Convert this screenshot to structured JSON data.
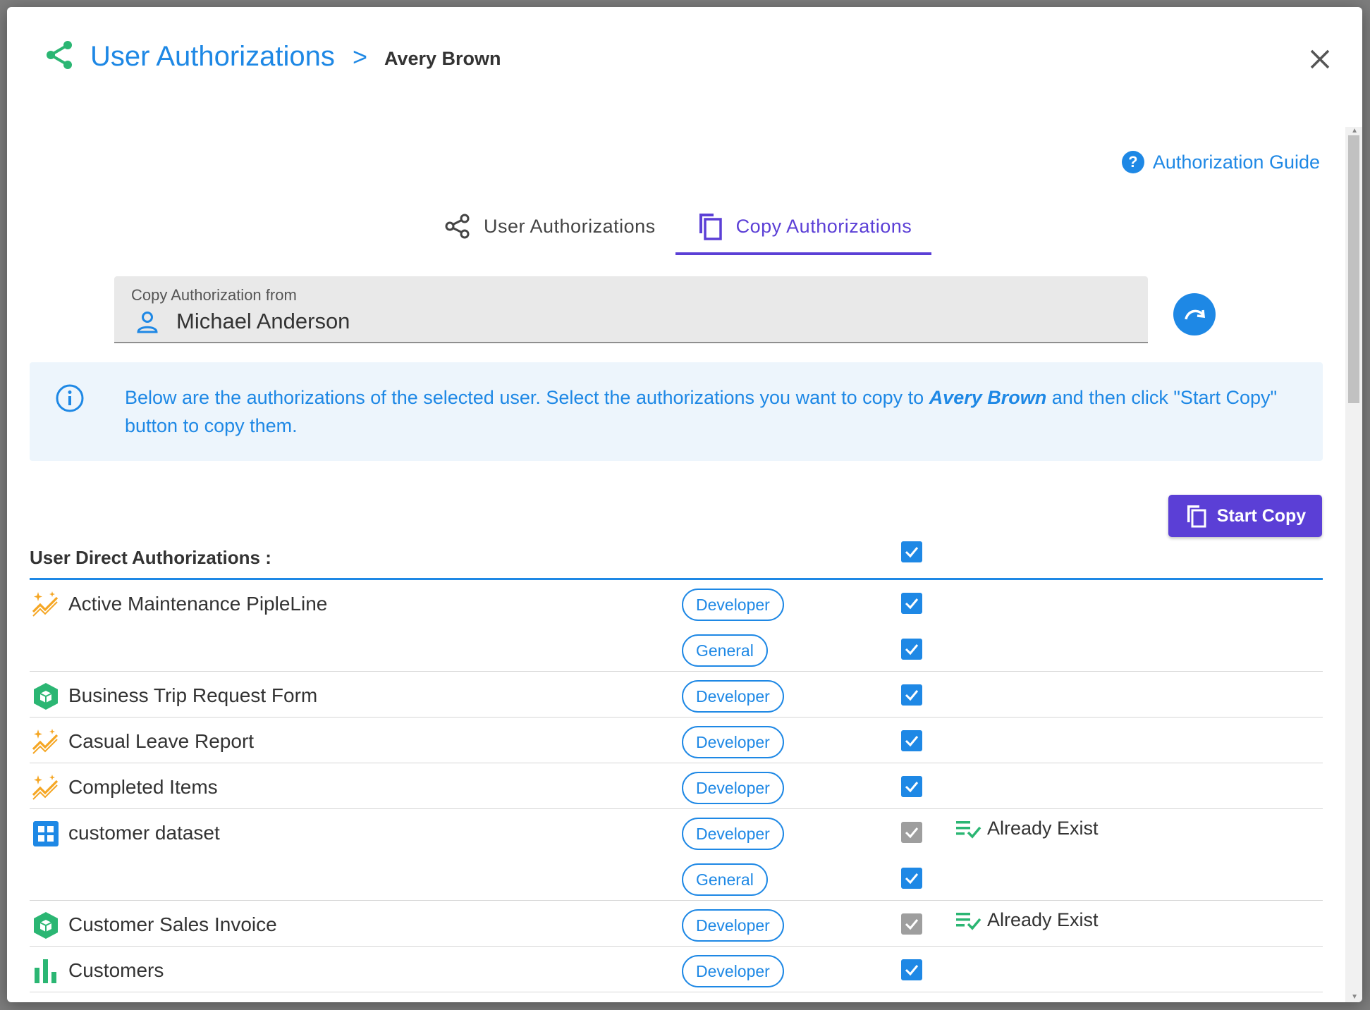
{
  "dialog": {
    "title": "User Authorizations",
    "separator": ">",
    "user": "Avery Brown"
  },
  "guide": {
    "label": "Authorization Guide",
    "icon": "help-circle-icon"
  },
  "tabs": [
    {
      "label": "User Authorizations",
      "icon": "share-icon",
      "active": false
    },
    {
      "label": "Copy Authorizations",
      "icon": "copy-icon",
      "active": true
    }
  ],
  "copy_from": {
    "label": "Copy Authorization from",
    "value": "Michael Anderson"
  },
  "info": {
    "text_before": "Below are the authorizations of the selected user. Select the authorizations you want to copy to ",
    "user": "Avery Brown",
    "text_after": " and then click \"Start Copy\" button to copy them."
  },
  "start_copy": {
    "label": "Start Copy"
  },
  "section": {
    "title": "User Direct Authorizations :"
  },
  "colors": {
    "accent": "#1e88e5",
    "primary": "#5b3fd6",
    "success": "#2bb673",
    "warning": "#f5a623"
  },
  "rows": [
    {
      "name": "Active Maintenance PipleLine",
      "icon": "sparkle-chart-icon",
      "roles": [
        {
          "label": "Developer",
          "checked": true,
          "exists": false
        },
        {
          "label": "General",
          "checked": true,
          "exists": false
        }
      ]
    },
    {
      "name": "Business Trip Request Form",
      "icon": "form-cube-icon",
      "roles": [
        {
          "label": "Developer",
          "checked": true,
          "exists": false
        }
      ]
    },
    {
      "name": "Casual Leave Report",
      "icon": "sparkle-chart-icon",
      "roles": [
        {
          "label": "Developer",
          "checked": true,
          "exists": false
        }
      ]
    },
    {
      "name": "Completed Items",
      "icon": "sparkle-chart-icon",
      "roles": [
        {
          "label": "Developer",
          "checked": true,
          "exists": false
        }
      ]
    },
    {
      "name": "customer dataset",
      "icon": "dataset-grid-icon",
      "roles": [
        {
          "label": "Developer",
          "checked": true,
          "exists": true,
          "exists_label": "Already Exist"
        },
        {
          "label": "General",
          "checked": true,
          "exists": false
        }
      ]
    },
    {
      "name": "Customer Sales Invoice",
      "icon": "form-cube-icon",
      "roles": [
        {
          "label": "Developer",
          "checked": true,
          "exists": true,
          "exists_label": "Already Exist"
        }
      ]
    },
    {
      "name": "Customers",
      "icon": "bar-chart-icon",
      "roles": [
        {
          "label": "Developer",
          "checked": true,
          "exists": false
        }
      ]
    }
  ]
}
